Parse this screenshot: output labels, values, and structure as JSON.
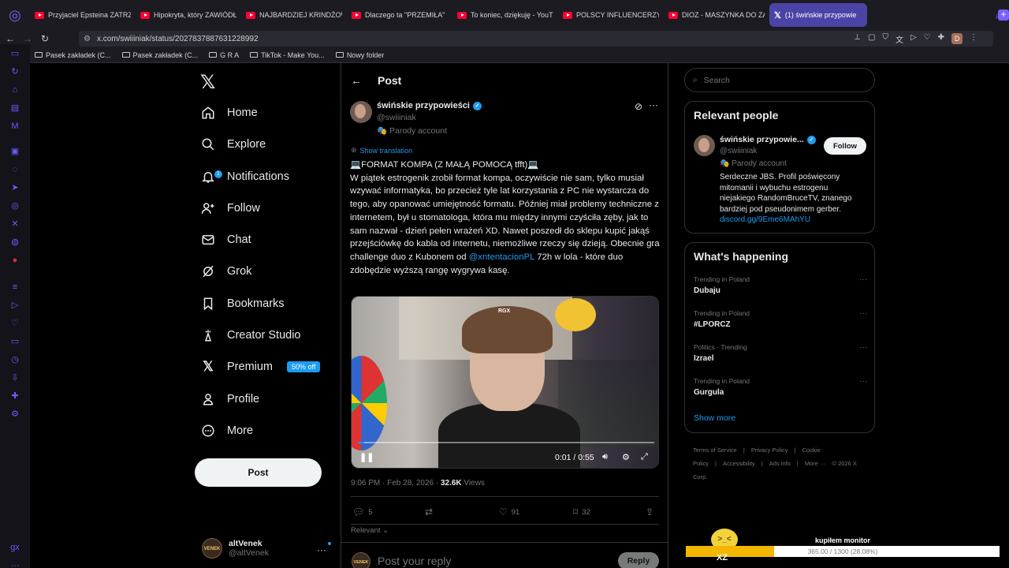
{
  "browser": {
    "tabs": [
      {
        "label": "Przyjaciel Epsteina ZATRZ",
        "type": "youtube"
      },
      {
        "label": "Hipokryta, który ZAWIÓDŁ",
        "type": "youtube"
      },
      {
        "label": "NAJBARDZIEJ KRINDŻOW",
        "type": "youtube"
      },
      {
        "label": "Dlaczego ta \"PRZEMIŁA\"",
        "type": "youtube"
      },
      {
        "label": "To koniec, dziękuję - YouT",
        "type": "youtube"
      },
      {
        "label": "POLSCY INFLUENCERZY",
        "type": "youtube"
      },
      {
        "label": "DIOZ - MASZYNKA DO ZA",
        "type": "youtube"
      },
      {
        "label": "(1) świńskie przypowie",
        "type": "x",
        "active": true
      }
    ],
    "url": "x.com/swiiiniak/status/2027837887631228992",
    "avatar_letter": "D",
    "bookmarks": [
      "Pasek zakładek (C...",
      "Pasek zakładek (C...",
      "G R A",
      "TikTok - Make You...",
      "Nowy folder"
    ]
  },
  "x_nav": {
    "items": [
      {
        "label": "Home",
        "icon": "home-icon"
      },
      {
        "label": "Explore",
        "icon": "search-icon"
      },
      {
        "label": "Notifications",
        "icon": "bell-icon",
        "badge": "1"
      },
      {
        "label": "Follow",
        "icon": "add-person-icon"
      },
      {
        "label": "Chat",
        "icon": "mail-icon"
      },
      {
        "label": "Grok",
        "icon": "grok-icon"
      },
      {
        "label": "Bookmarks",
        "icon": "bookmark-icon"
      },
      {
        "label": "Creator Studio",
        "icon": "creator-icon"
      },
      {
        "label": "Premium",
        "icon": "x-icon",
        "badge": "50% off"
      },
      {
        "label": "Profile",
        "icon": "person-icon"
      },
      {
        "label": "More",
        "icon": "more-circle-icon"
      }
    ],
    "post_label": "Post",
    "account": {
      "name": "altVenek",
      "handle": "@altVenek",
      "avatar_text": "VENEK"
    }
  },
  "post_view": {
    "header_title": "Post",
    "author": {
      "name": "świńskie przypowieści",
      "handle": "@swiiiniak",
      "label": "Parody account"
    },
    "show_translation": "Show translation",
    "text_title": "💻FORMAT KOMPA (Z MAŁĄ POMOCĄ tfft)💻",
    "text_body": "W piątek estrogenik zrobił format kompa, oczywiście nie sam, tylko musiał wzywać informatyka, bo przecież tyle lat korzystania z PC nie wystarcza do tego, aby opanować umiejętność formatu. Później miał problemy techniczne z internetem, był u stomatologa, która mu między innymi czyściła zęby, jak to sam nazwał - dzień pełen wrażeń XD. Nawet poszedł do sklepu kupić jakąś przejściówkę do kabla od internetu, niemożliwe rzeczy się dzieją. Obecnie gra challenge duo z Kubonem od",
    "mention": "@xntentacionPL",
    "text_end": "72h w lola - które duo zdobędzie wyższą rangę wygrywa kasę.",
    "video": {
      "time": "0:01 / 0:55",
      "progress": 0.02,
      "watermark": "RGX"
    },
    "meta_time": "9:06 PM · Feb 28, 2026 · ",
    "views_count": "32.6K",
    "views_label": " Views",
    "stats": {
      "replies": "5",
      "reposts": "",
      "likes": "91",
      "bookmarks": "32"
    },
    "relevant_label": "Relevant",
    "reply_placeholder": "Post your reply",
    "reply_button": "Reply",
    "reply_avatar_text": "VENEK"
  },
  "right": {
    "search_placeholder": "Search",
    "relevant_people_title": "Relevant people",
    "person": {
      "name": "świńskie przypowie...",
      "handle": "@swiiiniak",
      "label": "Parody account",
      "follow": "Follow",
      "bio": "Serdeczne JBS. Profil poświęcony mitomanii i wybuchu estrogenu niejakiego RandomBruceTV, znanego bardziej pod pseudonimem gerber.",
      "link": "discord.gg/9Eme6MAhYU"
    },
    "happening_title": "What's happening",
    "trends": [
      {
        "category": "Trending in Poland",
        "name": "Dubaju"
      },
      {
        "category": "Trending in Poland",
        "name": "#LPORCZ"
      },
      {
        "category": "Politics · Trending",
        "name": "Izrael"
      },
      {
        "category": "Trending in Poland",
        "name": "Gurgula"
      }
    ],
    "show_more": "Show more",
    "footer": [
      "Terms of Service",
      "|",
      "Privacy Policy",
      "|",
      "Cookie Policy",
      "|",
      "Accessibility",
      "|",
      "Ads info",
      "|",
      "More ···",
      "© 2026 X Corp."
    ]
  },
  "overlay": {
    "label": "kupiłem monitor",
    "progress_text": "365.00 / 1300 (28.08%)",
    "progress": 0.2808,
    "emoji_text": ">_<",
    "tag": "XZ"
  },
  "colors": {
    "accent": "#1d9bf0",
    "browser_accent": "#7b61ff",
    "overlay_fill": "#f3b700"
  }
}
